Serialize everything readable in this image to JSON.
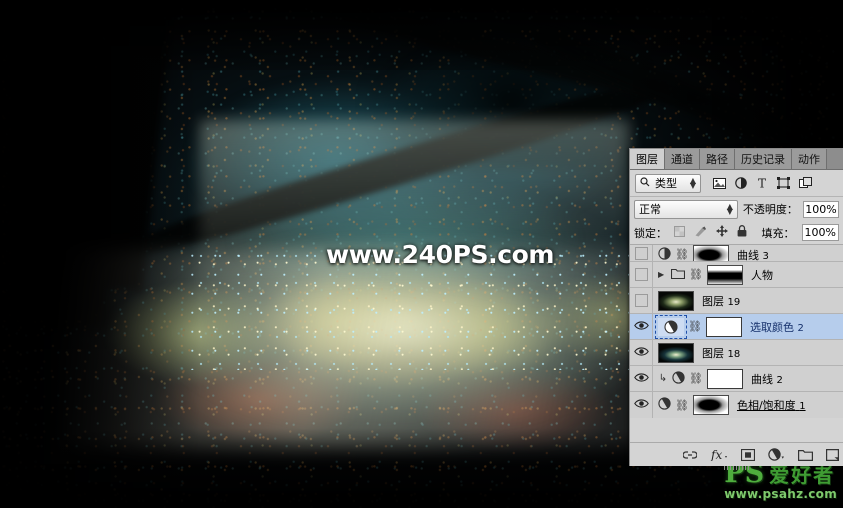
{
  "image": {
    "watermark_text": "www.240PS.com",
    "logo": {
      "ps": "PS",
      "cn": "爱好者",
      "url": "www.psahz.com"
    },
    "description": "Dark forest scene with glowing misty light over mossy rocks"
  },
  "panel": {
    "tabs": [
      {
        "label": "图层",
        "active": true
      },
      {
        "label": "通道",
        "active": false
      },
      {
        "label": "路径",
        "active": false
      },
      {
        "label": "历史记录",
        "active": false
      },
      {
        "label": "动作",
        "active": false
      }
    ],
    "filter": {
      "kind_label": "类型",
      "icons": [
        "search-icon",
        "pixel-layer-filter-icon",
        "adjustment-layer-filter-icon",
        "type-layer-filter-icon",
        "shape-layer-filter-icon",
        "smart-object-filter-icon"
      ]
    },
    "blend": {
      "mode": "正常",
      "opacity_label": "不透明度：",
      "opacity_value": "100%"
    },
    "lock": {
      "label": "锁定：",
      "icons": [
        "lock-transparent-pixels-icon",
        "lock-image-pixels-icon",
        "lock-position-icon",
        "lock-all-icon"
      ],
      "fill_label": "填充：",
      "fill_value": "100%"
    },
    "layers": [
      {
        "name": "曲线",
        "number": "3",
        "visible": false,
        "selected": false,
        "clipped_row": true,
        "thumb": "maskB",
        "has_mask": true,
        "mask": "white",
        "kind": "adjustment"
      },
      {
        "name": "人物",
        "number": "",
        "visible": false,
        "selected": false,
        "kind": "group",
        "expanded": false,
        "thumb": "maskA",
        "has_mask": true
      },
      {
        "name": "图层",
        "number": "19",
        "visible": false,
        "selected": false,
        "kind": "pixel",
        "thumb": "glowA"
      },
      {
        "name": "选取颜色",
        "number": "2",
        "visible": true,
        "selected": true,
        "kind": "adjustment",
        "thumb": "adjustment",
        "has_mask": true,
        "mask": "white"
      },
      {
        "name": "图层",
        "number": "18",
        "visible": true,
        "selected": false,
        "kind": "pixel",
        "thumb": "glowB"
      },
      {
        "name": "曲线",
        "number": "2",
        "visible": true,
        "selected": false,
        "kind": "adjustment",
        "clipping": true,
        "thumb": "adjustment",
        "has_mask": true,
        "mask": "white"
      },
      {
        "name": "色相/饱和度",
        "number": "1",
        "visible": true,
        "selected": false,
        "kind": "adjustment",
        "thumb": "adjustment",
        "has_mask": true,
        "mask": "maskB",
        "underline": true
      }
    ],
    "footer_icons": [
      "link-layers-icon",
      "layer-style-fx-icon",
      "add-layer-mask-icon",
      "new-adjustment-layer-icon",
      "new-group-icon",
      "new-layer-icon"
    ]
  },
  "colors": {
    "panel_bg": "#d4d4d4",
    "row_bg": "#d0d0d0",
    "selected_row": "#b6cdec",
    "tab_active": "#cfcfcf",
    "tab_inactive": "#9b9b9b",
    "logo_green": "#4fae3e"
  }
}
